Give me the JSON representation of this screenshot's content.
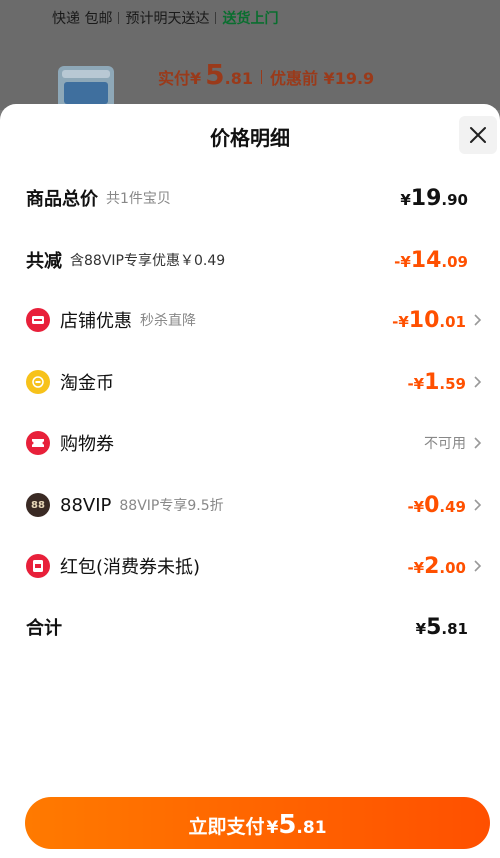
{
  "background": {
    "shipping": {
      "method": "快递 包邮",
      "eta": "预计明天送达",
      "delivery": "送货上门"
    },
    "price": {
      "pay_label": "实付",
      "currency": "¥",
      "int": "5",
      "dec": ".81",
      "before_discount": "优惠前 ¥19.9"
    }
  },
  "sheet": {
    "title": "价格明细",
    "total": {
      "label": "商品总价",
      "sub": "共1件宝贝",
      "cur": "¥",
      "int": "19",
      "dec": ".90"
    },
    "reduction": {
      "label": "共减",
      "sub": "含88VIP专享优惠￥0.49",
      "cur": "-¥",
      "int": "14",
      "dec": ".09"
    },
    "items": [
      {
        "label": "店铺优惠",
        "sub": "秒杀直降",
        "cur": "-¥",
        "int": "10",
        "dec": ".01",
        "icon": "shop-coupon-icon",
        "color": "#e8203a"
      },
      {
        "label": "淘金币",
        "sub": "",
        "cur": "-¥",
        "int": "1",
        "dec": ".59",
        "icon": "gold-coin-icon",
        "color": "#f7c21a"
      },
      {
        "label": "购物券",
        "sub": "",
        "status": "不可用",
        "icon": "shopping-voucher-icon",
        "color": "#e8203a"
      },
      {
        "label": "88VIP",
        "sub": "88VIP专享9.5折",
        "cur": "-¥",
        "int": "0",
        "dec": ".49",
        "icon": "vip88-icon",
        "color": "#3a2a24"
      },
      {
        "label": "红包(消费券未抵)",
        "sub": "",
        "cur": "-¥",
        "int": "2",
        "dec": ".00",
        "icon": "red-packet-icon",
        "color": "#e8203a"
      }
    ],
    "sum": {
      "label": "合计",
      "cur": "¥",
      "int": "5",
      "dec": ".81"
    },
    "pay_button": {
      "label": "立即支付",
      "cur": "¥",
      "int": "5",
      "dec": ".81"
    },
    "vip_badge_text": "88"
  },
  "colors": {
    "accent": "#ff5000",
    "sheet_bg": "#ffffff",
    "overlay": "#6b6b6b"
  }
}
